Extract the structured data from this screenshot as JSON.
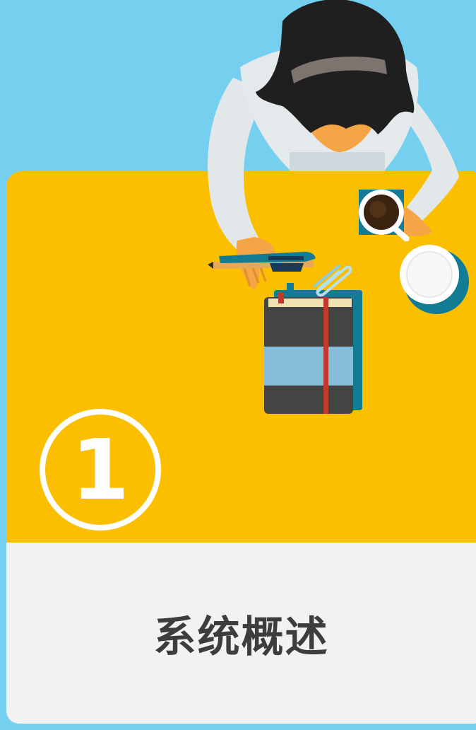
{
  "card": {
    "step_number": "1",
    "title": "系统概述"
  },
  "colors": {
    "background": "#75d0f0",
    "desk": "#fbbf00",
    "footer": "#f2f2f2",
    "title_text": "#3d3d3d"
  },
  "illustration": {
    "icons": [
      "person-icon",
      "coffee-cup-icon",
      "saucer-icon",
      "pen-icon",
      "notebook-icon",
      "paperclip-icon"
    ]
  }
}
